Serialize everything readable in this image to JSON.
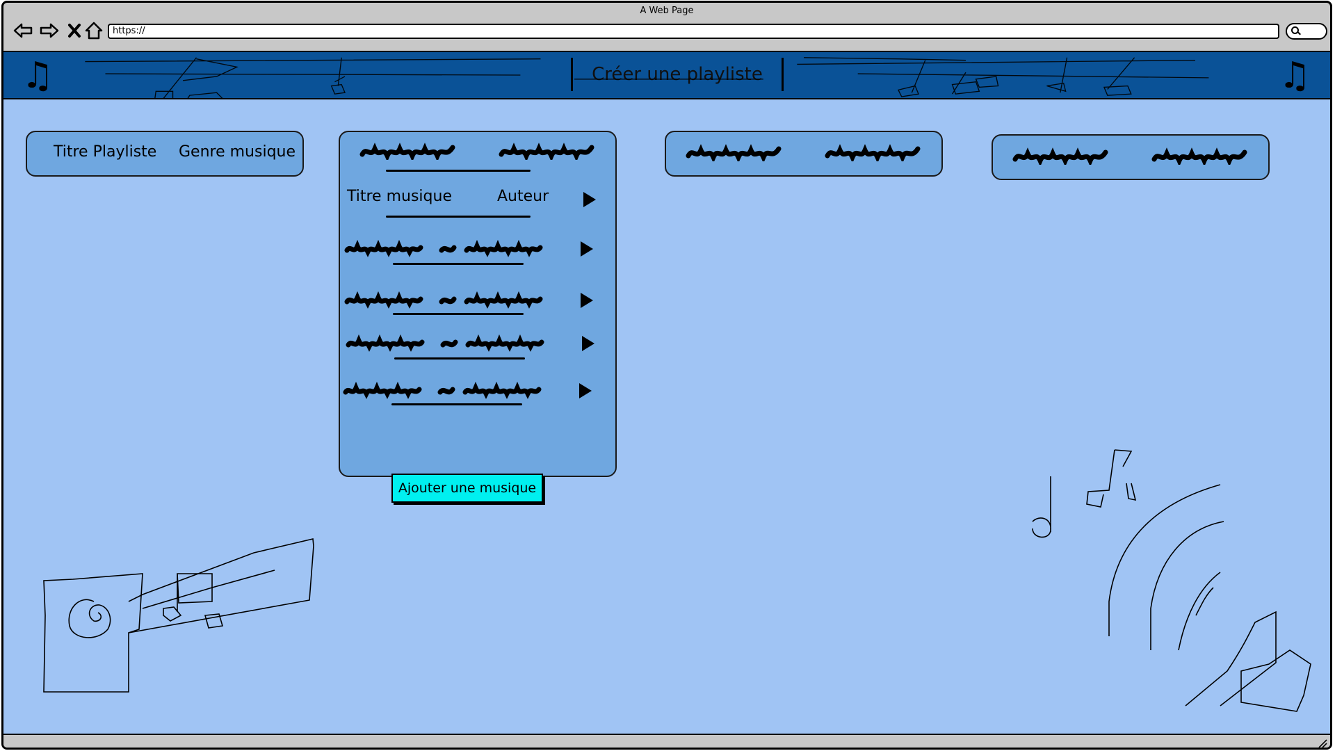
{
  "window": {
    "title": "A Web Page"
  },
  "browser": {
    "back_icon": "back-arrow-icon",
    "forward_icon": "forward-arrow-icon",
    "stop_icon": "close-icon",
    "home_icon": "home-icon",
    "url": "https://",
    "search_icon": "search-icon"
  },
  "header": {
    "title": "Créer une playliste",
    "left_icon": "music-note-icon",
    "right_icon": "music-note-icon"
  },
  "playlist_card": {
    "title_label": "Titre Playliste",
    "genre_label": "Genre musique"
  },
  "music_card": {
    "header_row": {
      "title": "Titre musique",
      "author": "Auteur"
    },
    "placeholder_rows": 4,
    "add_button": "Ajouter une musique"
  },
  "colors": {
    "header_bg": "#0a5297",
    "page_bg": "#a0c4f4",
    "card_bg": "#6fa7e0",
    "button_bg": "#00f0f0"
  }
}
